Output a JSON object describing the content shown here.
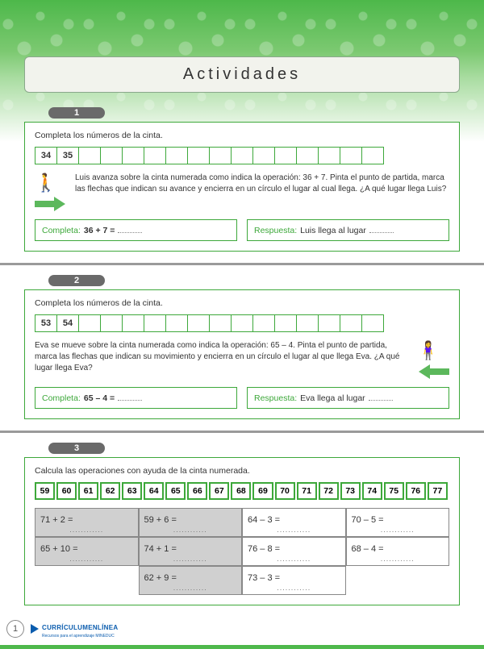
{
  "header": {
    "title": "Actividades"
  },
  "activity1": {
    "number": "1",
    "instruction": "Completa los números de la cinta.",
    "tape_start": [
      "34",
      "35"
    ],
    "tape_blanks": 14,
    "story": "Luis avanza sobre la cinta numerada como indica la operación: 36 + 7. Pinta el punto de partida, marca las flechas que indican su avance y encierra en un círculo el lugar al cual llega.  ¿A qué lugar llega Luis?",
    "completa_label": "Completa:",
    "completa_expr": "36 + 7  =",
    "respuesta_label": "Respuesta:",
    "respuesta_text": "Luis llega al lugar"
  },
  "activity2": {
    "number": "2",
    "instruction": "Completa los números de la cinta.",
    "tape_start": [
      "53",
      "54"
    ],
    "tape_blanks": 14,
    "story": "Eva se mueve sobre la cinta numerada como indica la operación: 65 – 4. Pinta el punto de partida, marca las flechas que indican su movimiento y encierra en un círculo el lugar al que llega Eva.  ¿A qué lugar llega Eva?",
    "completa_label": "Completa:",
    "completa_expr": "65 – 4  =",
    "respuesta_label": "Respuesta:",
    "respuesta_text": "Eva llega al lugar"
  },
  "activity3": {
    "number": "3",
    "instruction": "Calcula las operaciones con ayuda de la cinta numerada.",
    "tape": [
      "59",
      "60",
      "61",
      "62",
      "63",
      "64",
      "65",
      "66",
      "67",
      "68",
      "69",
      "70",
      "71",
      "72",
      "73",
      "74",
      "75",
      "76",
      "77"
    ],
    "grid": [
      {
        "expr": "71 + 2  =",
        "gray": true
      },
      {
        "expr": "59 + 6  =",
        "gray": true
      },
      {
        "expr": "64 – 3  =",
        "gray": false
      },
      {
        "expr": "70 – 5  =",
        "gray": false
      },
      {
        "expr": "65 + 10 =",
        "gray": true
      },
      {
        "expr": "74 + 1  =",
        "gray": true
      },
      {
        "expr": "76 – 8  =",
        "gray": false
      },
      {
        "expr": "68 – 4  =",
        "gray": false
      },
      {
        "expr": "",
        "empty": true
      },
      {
        "expr": "62 + 9  =",
        "gray": true
      },
      {
        "expr": "73 – 3  =",
        "gray": false
      },
      {
        "expr": "",
        "empty": true
      }
    ]
  },
  "footer": {
    "page": "1",
    "brand": "CURRÍCULUMENLÍNEA",
    "sub": "Recursos para el aprendizaje MINEDUC"
  }
}
